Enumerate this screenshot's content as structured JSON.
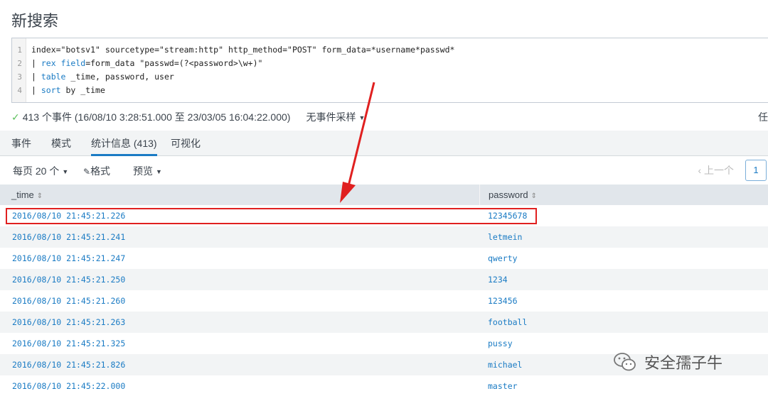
{
  "page_title": "新搜索",
  "search": {
    "line_numbers": [
      "1",
      "2",
      "3",
      "4"
    ],
    "lines": [
      [
        {
          "t": "index=\"botsv1\" sourcetype=\"stream:http\" http_method=\"POST\" form_data=*username*passwd*",
          "c": ""
        }
      ],
      [
        {
          "t": "| ",
          "c": "pipe"
        },
        {
          "t": "rex",
          "c": "kw"
        },
        {
          "t": " ",
          "c": ""
        },
        {
          "t": "field",
          "c": "kw"
        },
        {
          "t": "=form_data \"passwd=(?<password>\\w+)\"",
          "c": ""
        }
      ],
      [
        {
          "t": "| ",
          "c": "pipe"
        },
        {
          "t": "table",
          "c": "kw"
        },
        {
          "t": " _time, password, user",
          "c": ""
        }
      ],
      [
        {
          "t": "| ",
          "c": "pipe"
        },
        {
          "t": "sort",
          "c": "kw"
        },
        {
          "t": " by _time",
          "c": ""
        }
      ]
    ]
  },
  "status": {
    "check": "✓",
    "summary": "413 个事件 (16/08/10 3:28:51.000 至 23/03/05 16:04:22.000)",
    "sampling": "无事件采样",
    "right_cut": "任"
  },
  "tabs": [
    "事件",
    "模式",
    "统计信息 (413)",
    "可视化"
  ],
  "toolbar": {
    "per_page": "每页 20 个",
    "format": "格式",
    "preview": "预览",
    "prev": "‹ 上一个",
    "page": "1"
  },
  "table": {
    "headers": [
      "_time",
      "password"
    ],
    "rows": [
      [
        "2016/08/10 21:45:21.226",
        "12345678"
      ],
      [
        "2016/08/10 21:45:21.241",
        "letmein"
      ],
      [
        "2016/08/10 21:45:21.247",
        "qwerty"
      ],
      [
        "2016/08/10 21:45:21.250",
        "1234"
      ],
      [
        "2016/08/10 21:45:21.260",
        "123456"
      ],
      [
        "2016/08/10 21:45:21.263",
        "football"
      ],
      [
        "2016/08/10 21:45:21.325",
        "pussy"
      ],
      [
        "2016/08/10 21:45:21.826",
        "michael"
      ],
      [
        "2016/08/10 21:45:22.000",
        "master"
      ]
    ],
    "highlighted_row": 0
  },
  "watermark": "安全孺子牛",
  "colors": {
    "accent": "#1a7bc4",
    "highlight": "#e02020",
    "success": "#5cc05c"
  },
  "icons": [
    "check-icon",
    "chevron-down-icon",
    "pencil-icon",
    "sort-icon",
    "wechat-icon",
    "arrow-annotation"
  ]
}
